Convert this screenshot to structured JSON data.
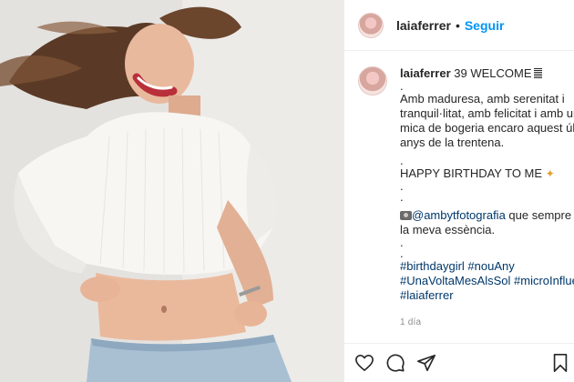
{
  "post": {
    "username": "laiaferrer",
    "follow_label": "Seguir",
    "separator": "•",
    "caption": {
      "username": "laiaferrer",
      "title": "39 WELCOME",
      "dot": ".",
      "paragraph": [
        "Amb maduresa, amb serenitat i",
        "tranquil·litat, amb felicitat i amb una",
        "mica de bogeria encaro aquest últim",
        "anys de la trentena."
      ],
      "birthday": "HAPPY BIRTHDAY TO ME",
      "credit_mention": "@ambytfotografia",
      "credit_rest": " que sempre ca",
      "credit_line2": "la meva essència.",
      "hashtags": [
        "#birthdaygirl #nouAny",
        "#UnaVoltaMesAlsSol #microInfluenc",
        "#laiaferrer"
      ]
    },
    "time_ago": "1 día"
  },
  "icons": {
    "like": "heart-icon",
    "comment": "comment-icon",
    "share": "share-icon",
    "save": "bookmark-icon"
  },
  "colors": {
    "follow": "#0095f6",
    "link": "#00376b",
    "muted": "#8e8e8e",
    "text": "#262626"
  }
}
